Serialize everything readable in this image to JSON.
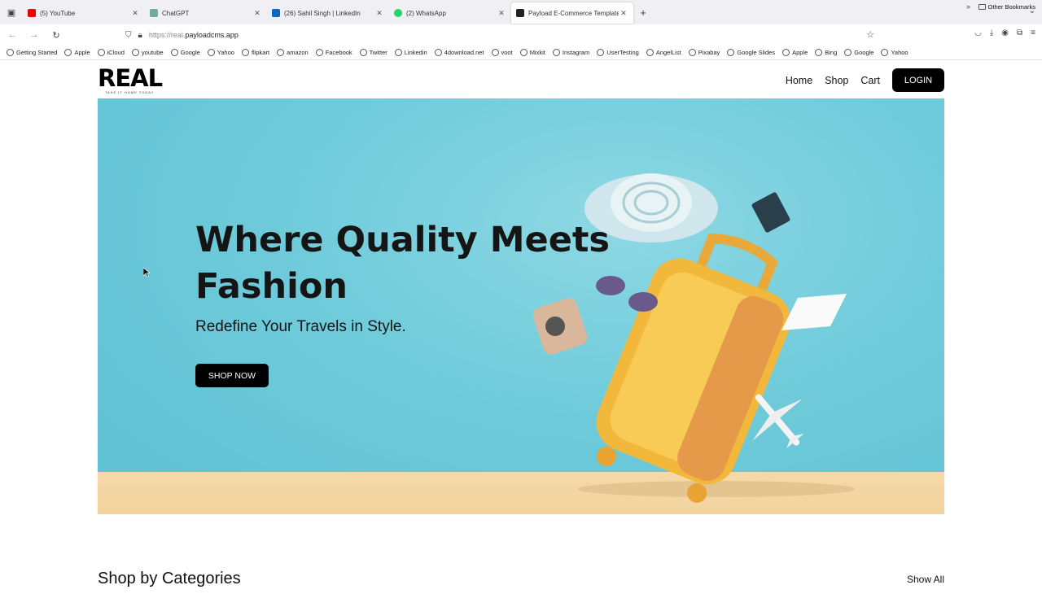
{
  "browser": {
    "tabs": [
      {
        "label": "(5) YouTube",
        "color": "#e00"
      },
      {
        "label": "ChatGPT",
        "color": "#74aa9c"
      },
      {
        "label": "(26) Sahil Singh | LinkedIn",
        "color": "#0a66c2"
      },
      {
        "label": "(2) WhatsApp",
        "color": "#25d366"
      },
      {
        "label": "Payload E-Commerce Template",
        "color": "#222"
      }
    ],
    "url_prefix": "https://real.",
    "url_domain": "payloadcms.app",
    "bookmarks": [
      "Getting Started",
      "Apple",
      "iCloud",
      "youtube",
      "Google",
      "Yahoo",
      "flipkart",
      "amazon",
      "Facebook",
      "Twitter",
      "Linkedin",
      "4download.net",
      "voot",
      "Mixkit",
      "Instagram",
      "UserTesting",
      "AngelList",
      "Pixabay",
      "Google Slides",
      "Apple",
      "Bing",
      "Google",
      "Yahoo"
    ],
    "other_bookmarks": "Other Bookmarks"
  },
  "header": {
    "logo_text": "REAL",
    "logo_tagline": "TAKE IT HOME TODAY",
    "nav": [
      "Home",
      "Shop",
      "Cart"
    ],
    "login_label": "LOGIN"
  },
  "hero": {
    "title_line1": "Where Quality Meets",
    "title_line2": "Fashion",
    "subtitle": "Redefine Your Travels in Style.",
    "cta_label": "SHOP NOW"
  },
  "categories": {
    "title": "Shop by Categories",
    "show_all": "Show All"
  }
}
